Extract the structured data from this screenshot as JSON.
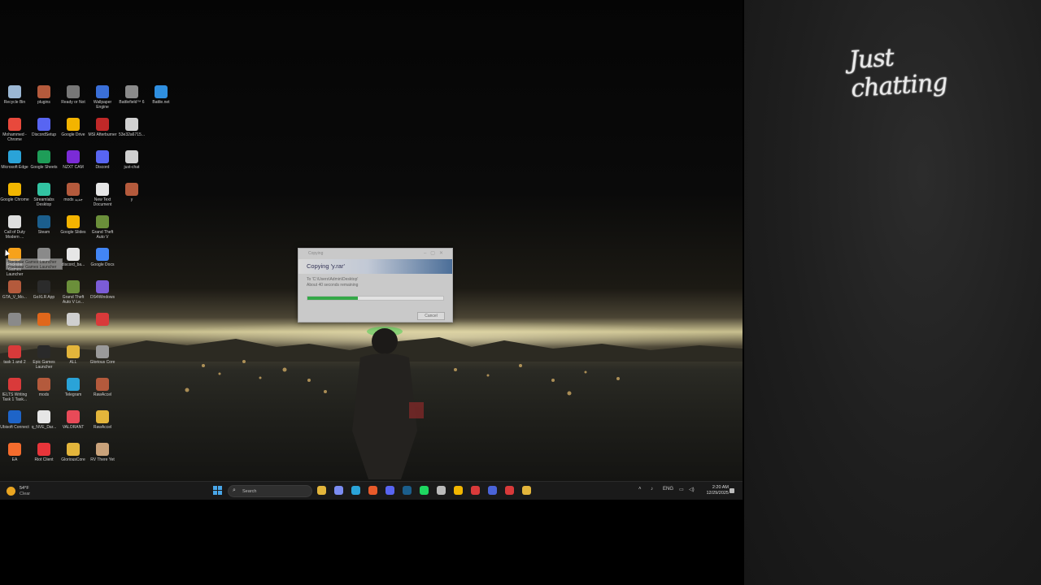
{
  "side_panel": {
    "title": "Just chatting"
  },
  "desktop_icons": [
    {
      "label": "Recycle Bin",
      "color": "#9bb7d4"
    },
    {
      "label": "plugins",
      "color": "#b45a3c"
    },
    {
      "label": "Ready or Not",
      "color": "#777777"
    },
    {
      "label": "Wallpaper Engine",
      "color": "#3a6fd8"
    },
    {
      "label": "Battlefield™ 6",
      "color": "#8a8a8a"
    },
    {
      "label": "Battle.net",
      "color": "#2f8fe0"
    },
    {
      "label": "Mohammed - Chrome",
      "color": "#e8493c"
    },
    {
      "label": "DiscordSetup",
      "color": "#5865f2"
    },
    {
      "label": "Google Drive",
      "color": "#f3b400"
    },
    {
      "label": "MSI Afterburner",
      "color": "#c02828"
    },
    {
      "label": "53e32a6715...",
      "color": "#d0d0d0"
    },
    {
      "label": "Microsoft Edge",
      "color": "#2aa3d8"
    },
    {
      "label": "Google Sheets",
      "color": "#1e9d58"
    },
    {
      "label": "NZXT CAM",
      "color": "#7b2bd6"
    },
    {
      "label": "Discord",
      "color": "#5865f2"
    },
    {
      "label": "just-chat",
      "color": "#d0d0d0"
    },
    {
      "label": "Google Chrome",
      "color": "#f2b600"
    },
    {
      "label": "Streamlabs Desktop",
      "color": "#32c3a2"
    },
    {
      "label": "mods جديد",
      "color": "#b45a3c"
    },
    {
      "label": "New Text Document",
      "color": "#e6e6e6"
    },
    {
      "label": "y",
      "color": "#b45a3c"
    },
    {
      "label": "Call of Duty Modern ...",
      "color": "#dedede"
    },
    {
      "label": "Steam",
      "color": "#1b5e8c"
    },
    {
      "label": "Google Slides",
      "color": "#f4b400"
    },
    {
      "label": "Grand Theft Auto V",
      "color": "#6b8f3a"
    },
    {
      "label": "Rockstar Games Launcher",
      "color": "#f7a21b"
    },
    {
      "label": "",
      "color": "#8a8a8a"
    },
    {
      "label": "discord_ba...",
      "color": "#e6e6e6"
    },
    {
      "label": "Google Docs",
      "color": "#4285f4"
    },
    {
      "label": "GTA_V_Mo...",
      "color": "#b45a3c"
    },
    {
      "label": "GoXLR App",
      "color": "#2b2b2b"
    },
    {
      "label": "Grand Theft Auto V Le...",
      "color": "#6b8f3a"
    },
    {
      "label": "DS4Windows",
      "color": "#7b5cd6"
    },
    {
      "label": "",
      "color": "#8a8a8a"
    },
    {
      "label": "",
      "color": "#e0671b"
    },
    {
      "label": "",
      "color": "#cfcfcf"
    },
    {
      "label": "",
      "color": "#d93a3a"
    },
    {
      "label": "task 1 and 2",
      "color": "#d93a3a"
    },
    {
      "label": "Epic Games Launcher",
      "color": "#2a2a2a"
    },
    {
      "label": "ALL",
      "color": "#e3b53b"
    },
    {
      "label": "Glorious Core",
      "color": "#9a9a9a"
    },
    {
      "label": "IELTS Writing Task 1 Task...",
      "color": "#d93a3a"
    },
    {
      "label": "mods",
      "color": "#b45a3c"
    },
    {
      "label": "Telegram",
      "color": "#2aa3d8"
    },
    {
      "label": "RawAccel",
      "color": "#b45a3c"
    },
    {
      "label": "Ubisoft Connect",
      "color": "#1e64c8"
    },
    {
      "label": "q_NVE_Dar...",
      "color": "#e6e6e6"
    },
    {
      "label": "VALORANT",
      "color": "#e84a58"
    },
    {
      "label": "RawAccel",
      "color": "#e3b53b"
    },
    {
      "label": "EA",
      "color": "#f56c2d"
    },
    {
      "label": "Riot Client",
      "color": "#e8353a"
    },
    {
      "label": "GloriousCore",
      "color": "#e3b53b"
    },
    {
      "label": "RV There Yet",
      "color": "#c9a27a"
    }
  ],
  "tooltip": {
    "text": "Rockstar Games Launcher Rockstar Games Launcher"
  },
  "dialog": {
    "title": "Copying",
    "header": "Copying 'y.rar'",
    "to_line": "To 'C:\\Users\\Admin\\Desktop'",
    "remaining": "About 40 seconds remaining",
    "progress": 0.37,
    "cancel": "Cancel"
  },
  "taskbar": {
    "weather_temp": "54°F",
    "weather_cond": "Clear",
    "search_label": "Search",
    "apps": [
      {
        "name": "file-explorer-icon",
        "color": "#e3b53b"
      },
      {
        "name": "copilot-icon",
        "color": "#7b8cf2"
      },
      {
        "name": "edge-icon",
        "color": "#2aa3d8"
      },
      {
        "name": "brave-icon",
        "color": "#e85a2a"
      },
      {
        "name": "discord-icon",
        "color": "#5865f2"
      },
      {
        "name": "steam-icon",
        "color": "#1b5e8c"
      },
      {
        "name": "spotify-icon",
        "color": "#1ed760"
      },
      {
        "name": "github-icon",
        "color": "#bbbbbb"
      },
      {
        "name": "chrome-icon",
        "color": "#f2b600"
      },
      {
        "name": "recorder-icon",
        "color": "#d93a3a"
      },
      {
        "name": "discord-ptb-icon",
        "color": "#4a63d8"
      },
      {
        "name": "media-icon",
        "color": "#d93a3a"
      },
      {
        "name": "folder-icon",
        "color": "#e3b53b"
      }
    ],
    "tray_lang": "ENG",
    "time": "2:20 AM",
    "date": "12/29/2025"
  }
}
